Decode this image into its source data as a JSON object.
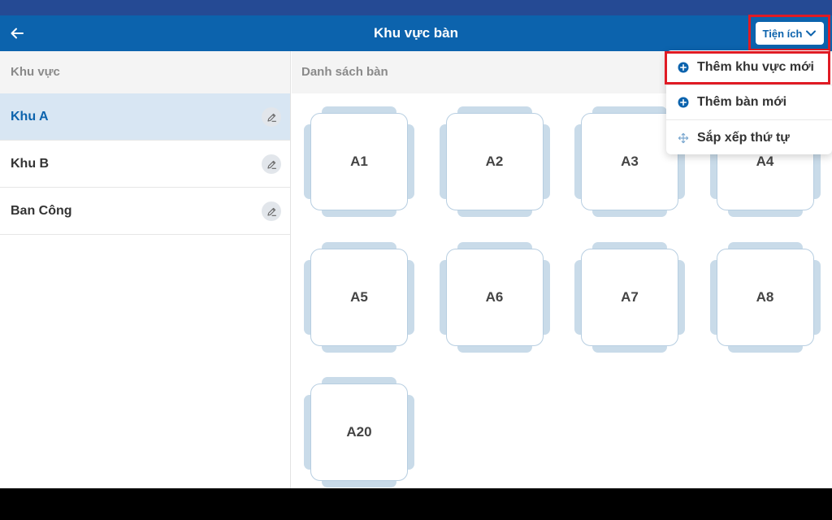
{
  "header": {
    "title": "Khu vực bàn",
    "utilities_label": "Tiện ích"
  },
  "areas": {
    "header": "Khu vực",
    "items": [
      {
        "label": "Khu A",
        "selected": true
      },
      {
        "label": "Khu B",
        "selected": false
      },
      {
        "label": "Ban Công",
        "selected": false
      }
    ]
  },
  "tables": {
    "header": "Danh sách bàn",
    "items": [
      "A1",
      "A2",
      "A3",
      "A4",
      "A5",
      "A6",
      "A7",
      "A8",
      "A20"
    ]
  },
  "menu": {
    "items": [
      {
        "label": "Thêm khu vực mới",
        "icon": "plus-circle-icon",
        "highlighted": true
      },
      {
        "label": "Thêm bàn mới",
        "icon": "plus-circle-icon",
        "highlighted": false
      },
      {
        "label": "Sắp xếp thứ tự",
        "icon": "move-icon",
        "highlighted": false
      }
    ]
  },
  "colors": {
    "status_bar": "#254a94",
    "app_bar": "#0c63ad",
    "selected_row": "#d8e6f3",
    "chair": "#c9dbe9",
    "highlight": "#e01b24"
  }
}
